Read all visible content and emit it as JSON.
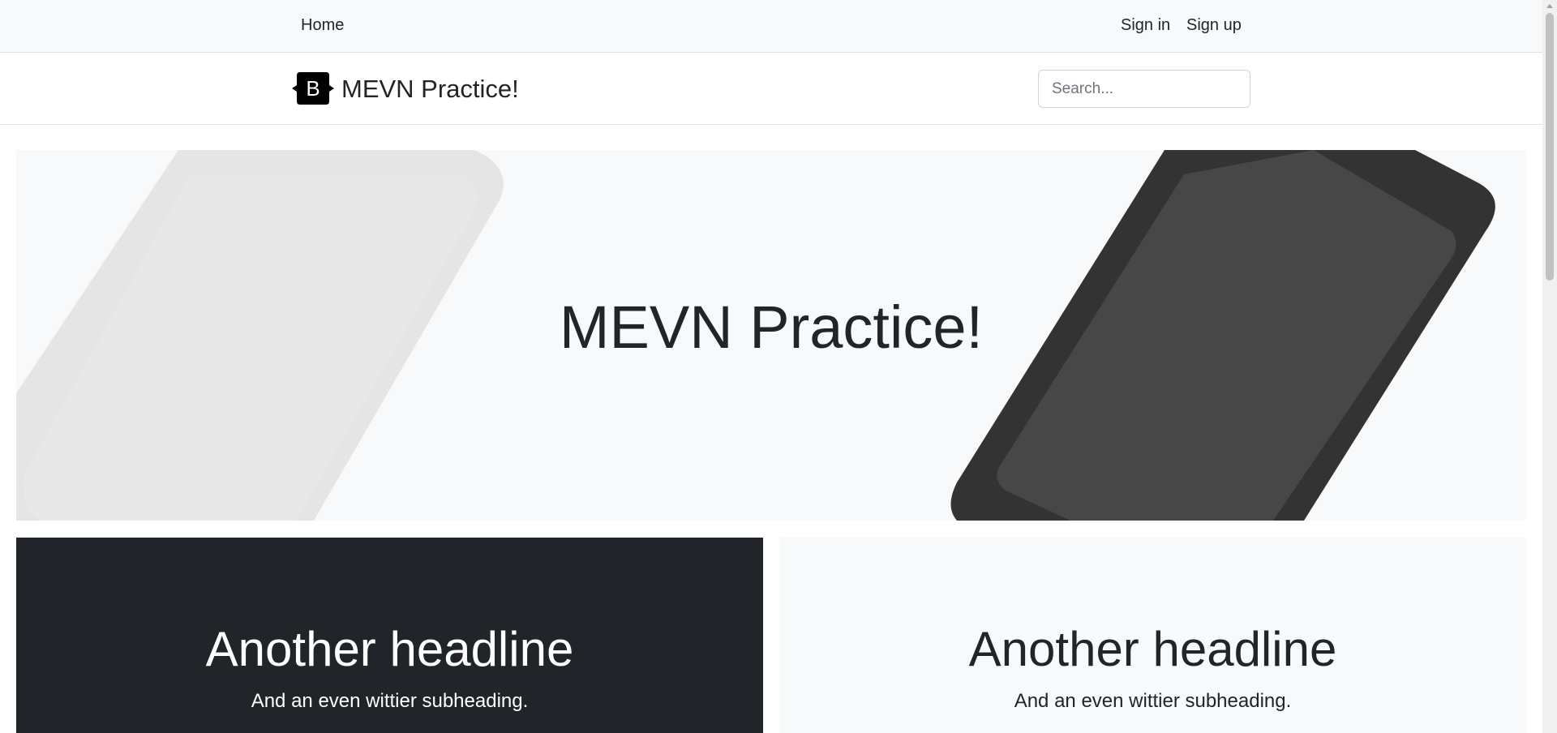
{
  "topnav": {
    "home": "Home",
    "sign_in": "Sign in",
    "sign_up": "Sign up"
  },
  "header": {
    "logo_letter": "B",
    "brand": "MEVN Practice!",
    "search_placeholder": "Search..."
  },
  "hero": {
    "title": "MEVN Practice!"
  },
  "panels": [
    {
      "headline": "Another headline",
      "subheading": "And an even wittier subheading."
    },
    {
      "headline": "Another headline",
      "subheading": "And an even wittier subheading."
    }
  ],
  "colors": {
    "topbar_bg": "#f8f9fa",
    "dark_panel": "#212529",
    "light_panel": "#f8f9fa",
    "phone_dark": "#333333",
    "phone_light": "#e5e5e5"
  }
}
